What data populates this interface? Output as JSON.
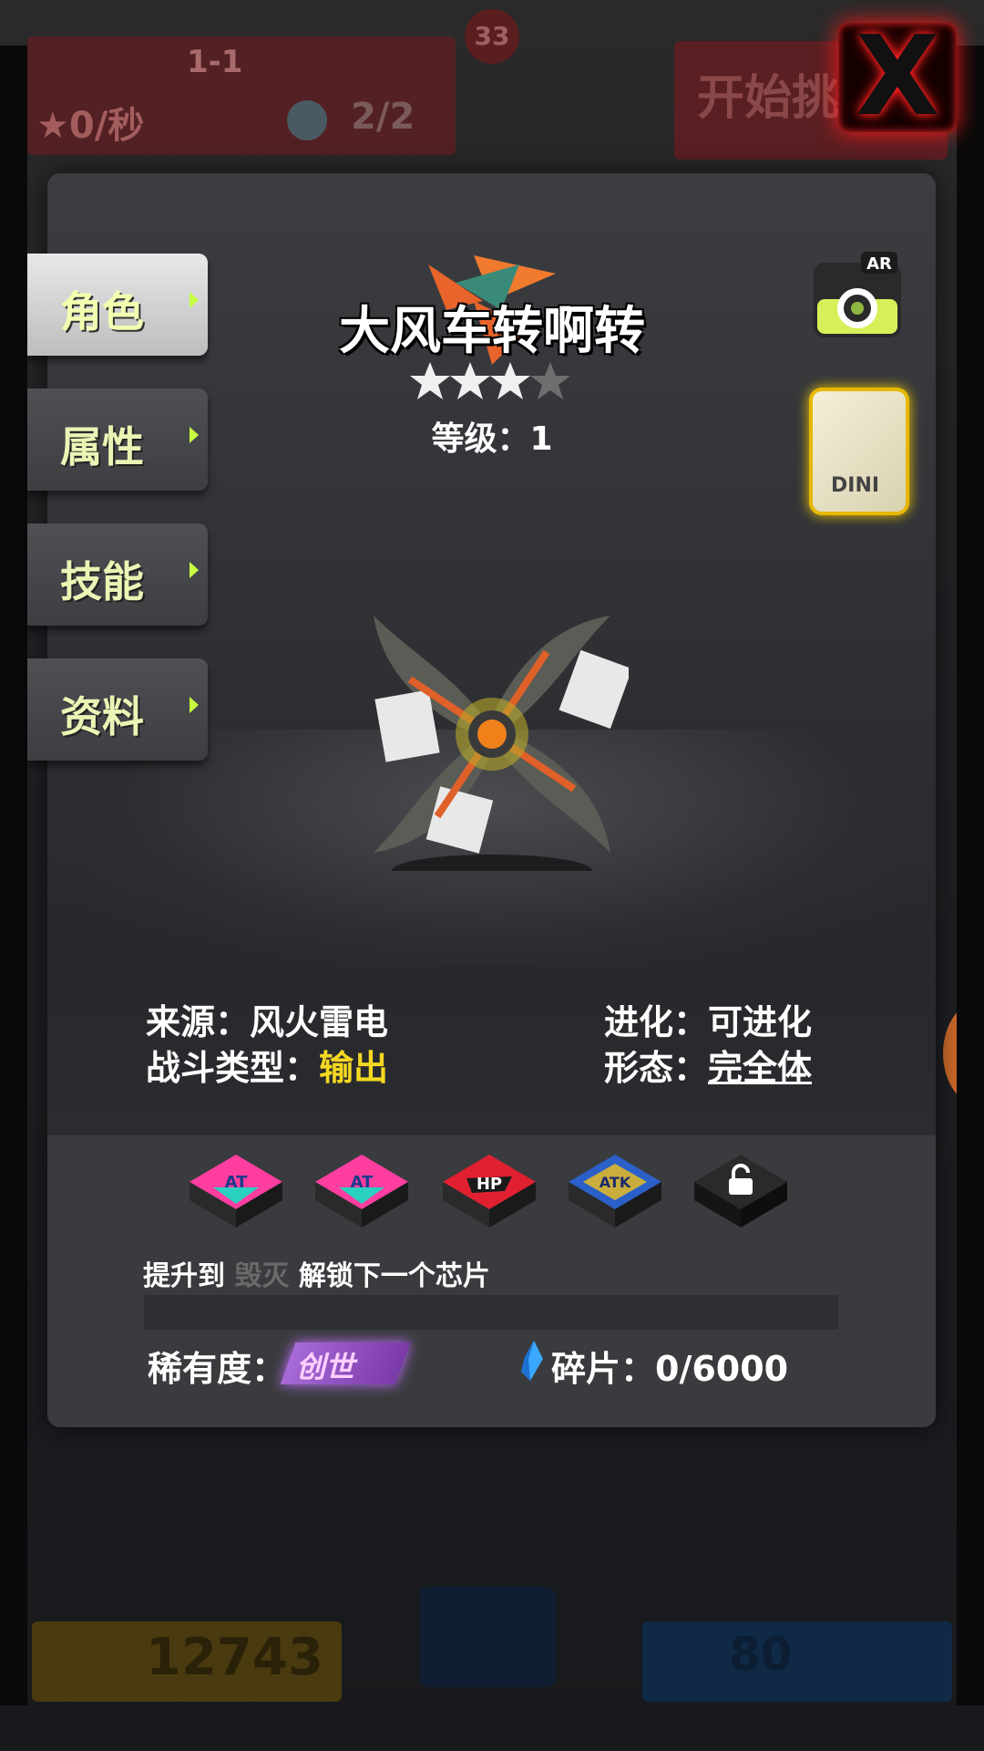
{
  "background": {
    "stage_label": "1-1",
    "rate_text": "0/秒",
    "bear_count": "2/2",
    "badge_number": "33",
    "start_label": "开始挑",
    "coins": "12743",
    "stars": "80"
  },
  "close_label": "X",
  "tabs": [
    {
      "label": "角色",
      "active": true
    },
    {
      "label": "属性",
      "active": false
    },
    {
      "label": "技能",
      "active": false
    },
    {
      "label": "资料",
      "active": false
    }
  ],
  "character": {
    "name": "大风车转啊转",
    "stars_filled": 3,
    "stars_total": 4,
    "level_text": "等级：1"
  },
  "ar_label": "AR",
  "card_label": "DINI",
  "info": {
    "source_label": "来源：",
    "source_value": "风火雷电",
    "type_label": "战斗类型：",
    "type_value": "输出",
    "evolve_label": "进化：",
    "evolve_value": "可进化",
    "form_label": "形态：",
    "form_value": "完全体"
  },
  "chips": [
    {
      "name": "chip-at-1",
      "label": "AT",
      "colors": [
        "#ff3ea0",
        "#2ad0c0"
      ]
    },
    {
      "name": "chip-at-2",
      "label": "AT",
      "colors": [
        "#ff3ea0",
        "#2ad0c0"
      ]
    },
    {
      "name": "chip-hp",
      "label": "HP",
      "colors": [
        "#e02030",
        "#1a1a1a"
      ]
    },
    {
      "name": "chip-atk",
      "label": "ATK",
      "colors": [
        "#f2c21a",
        "#2a60c8"
      ]
    },
    {
      "name": "chip-locked",
      "label": "",
      "colors": [
        "#2a2a2a",
        "#111111"
      ]
    }
  ],
  "unlock": {
    "prefix": "提升到",
    "tier": "毁灭",
    "suffix": "解锁下一个芯片"
  },
  "rarity": {
    "label": "稀有度：",
    "value": "创世"
  },
  "shards": {
    "label": "碎片：0/6000",
    "current": 0,
    "total": 6000
  },
  "colors": {
    "accent_green": "#c8ff40",
    "highlight_yellow": "#f5d821",
    "rarity_purple": "#a86ad8",
    "close_red": "#ff1a1a"
  }
}
